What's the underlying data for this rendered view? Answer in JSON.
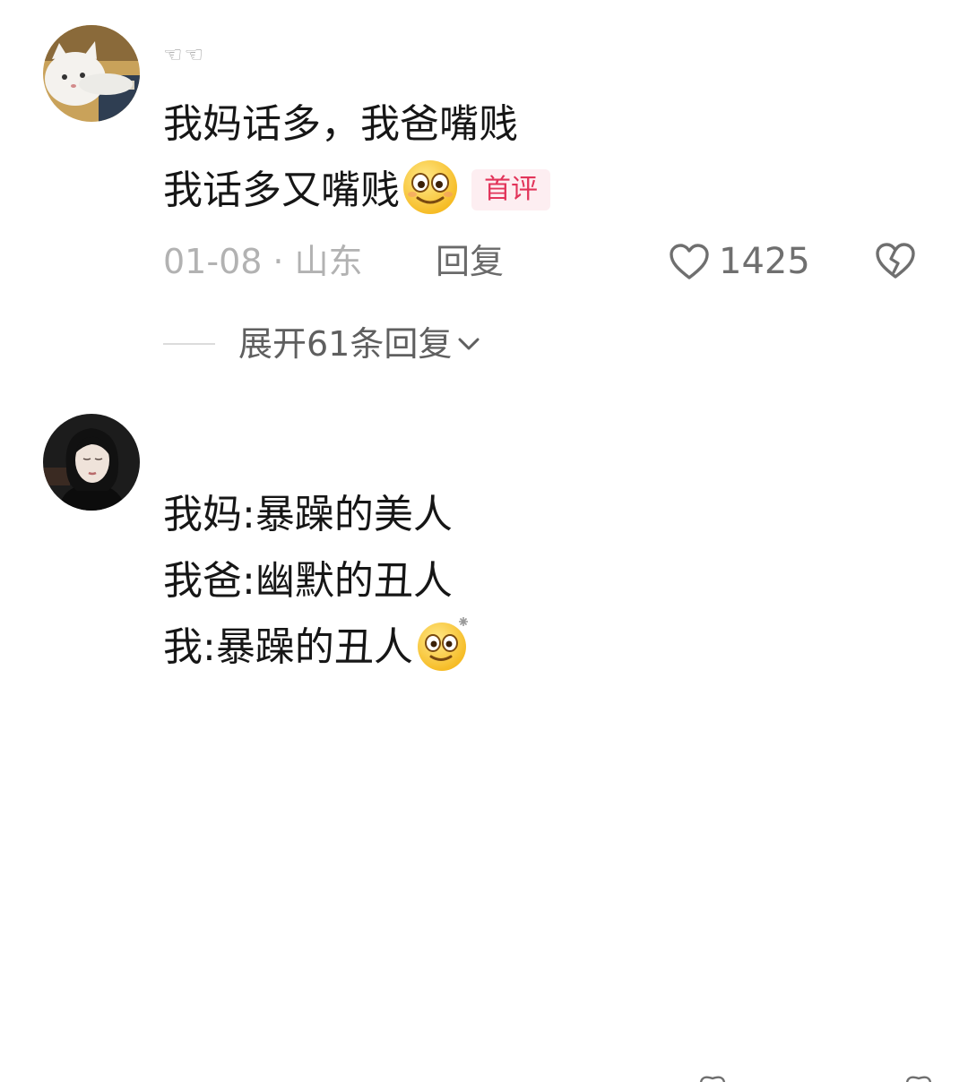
{
  "comments": [
    {
      "username": "☜☜",
      "lines": [
        "我妈话多，我爸嘴贱",
        "我话多又嘴贱"
      ],
      "tag": "首评",
      "date": "01-08",
      "separator": "·",
      "location": "山东",
      "reply_label": "回复",
      "likes": "1425",
      "expand_label": "展开61条回复"
    },
    {
      "username": "",
      "lines": [
        "我妈:暴躁的美人",
        "我爸:幽默的丑人",
        "我:暴躁的丑人"
      ]
    }
  ],
  "icons": {
    "like": "heart-outline-icon",
    "dislike": "broken-heart-icon",
    "expand": "chevron-down-icon",
    "emoji_1": "smiling-emoji-icon",
    "emoji_2": "dizzy-smiling-emoji-icon"
  },
  "colors": {
    "tag_text": "#e2345a",
    "tag_bg": "#fdeef1",
    "meta_gray": "#b2b2b2",
    "text": "#161616"
  }
}
